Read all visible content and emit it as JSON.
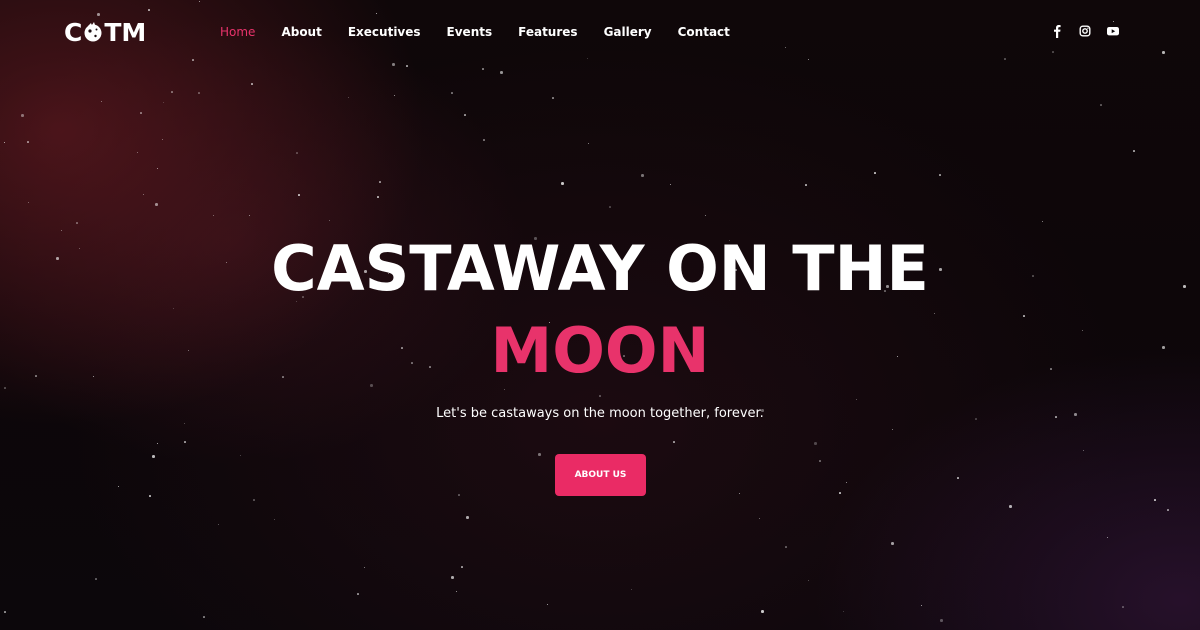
{
  "header": {
    "logo": {
      "left": "C",
      "right": "TM",
      "icon": "moon-astronaut-icon"
    },
    "nav": [
      {
        "label": "Home",
        "active": true
      },
      {
        "label": "About",
        "active": false
      },
      {
        "label": "Executives",
        "active": false
      },
      {
        "label": "Events",
        "active": false
      },
      {
        "label": "Features",
        "active": false
      },
      {
        "label": "Gallery",
        "active": false
      },
      {
        "label": "Contact",
        "active": false
      }
    ],
    "social": [
      {
        "icon": "facebook-icon"
      },
      {
        "icon": "instagram-icon"
      },
      {
        "icon": "youtube-icon"
      }
    ]
  },
  "hero": {
    "title_line1": "CASTAWAY ON THE",
    "title_line2": "MOON",
    "subtitle": "Let's be castaways on the moon together, forever.",
    "cta_label": "ABOUT US"
  },
  "colors": {
    "accent": "#e8336b",
    "button": "#ea2b65",
    "text": "#ffffff",
    "background": "#0c070a"
  }
}
